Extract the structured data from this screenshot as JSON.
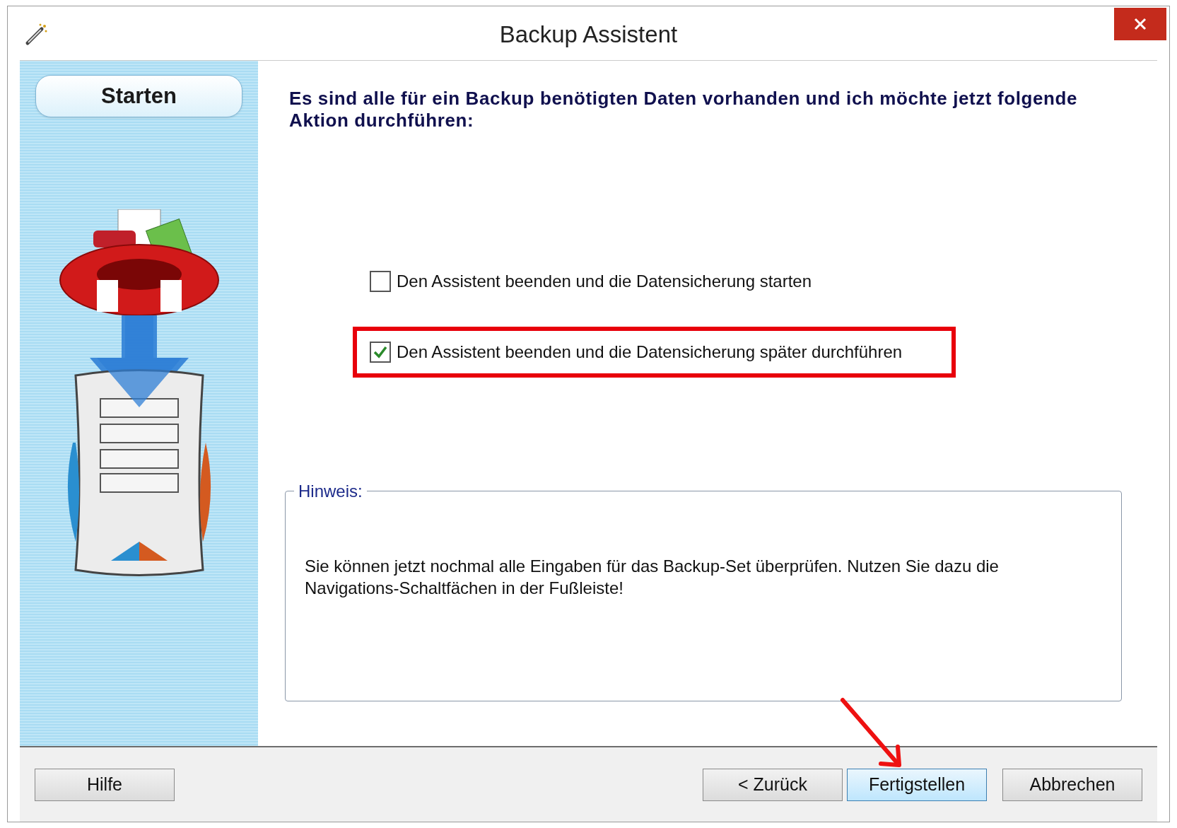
{
  "window": {
    "title": "Backup Assistent"
  },
  "sidebar": {
    "step": "Starten"
  },
  "heading": "Es sind alle für ein Backup benötigten Daten vorhanden und ich möchte jetzt folgende Aktion durchführen:",
  "options": [
    {
      "label": "Den Assistent beenden und die Datensicherung starten",
      "checked": false,
      "highlighted": false
    },
    {
      "label": "Den Assistent beenden und die Datensicherung später durchführen",
      "checked": true,
      "highlighted": true
    }
  ],
  "hint": {
    "legend": "Hinweis:",
    "text": "Sie können jetzt nochmal alle Eingaben für das Backup-Set überprüfen. Nutzen Sie dazu die Navigations-Schaltfächen in der Fußleiste!"
  },
  "buttons": [
    {
      "label": "Hilfe",
      "kind": "help",
      "focused": false
    },
    {
      "label": "< Zurück",
      "kind": "nav",
      "focused": false
    },
    {
      "label": "Fertigstellen",
      "kind": "nav",
      "focused": true
    },
    {
      "label": "Abbrechen",
      "kind": "nav",
      "focused": false
    }
  ]
}
